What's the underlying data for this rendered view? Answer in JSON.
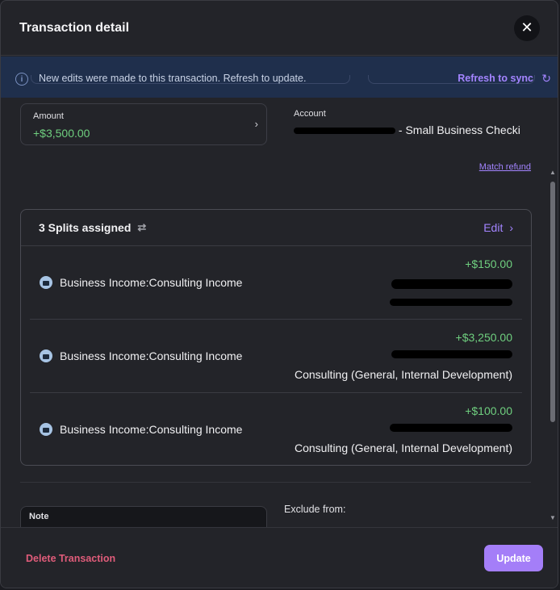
{
  "header": {
    "title": "Transaction detail",
    "close_icon": "close-icon"
  },
  "banner": {
    "message": "New edits were made to this transaction. Refresh to update.",
    "refresh_label": "Refresh to sync",
    "icon": "info-icon"
  },
  "amount": {
    "label": "Amount",
    "value": "+$3,500.00"
  },
  "account": {
    "label": "Account",
    "value_suffix": " - Small Business Checki"
  },
  "match_refund_label": "Match refund",
  "splits": {
    "title": "3 Splits assigned",
    "edit_label": "Edit",
    "rows": [
      {
        "category": "Business Income:Consulting Income",
        "amount": "+$150.00",
        "line3": ""
      },
      {
        "category": "Business Income:Consulting Income",
        "amount": "+$3,250.00",
        "line3": "Consulting (General, Internal Development)"
      },
      {
        "category": "Business Income:Consulting Income",
        "amount": "+$100.00",
        "line3": "Consulting (General, Internal Development)"
      }
    ]
  },
  "note": {
    "label": "Note"
  },
  "exclude_label": "Exclude from:",
  "footer": {
    "delete_label": "Delete Transaction",
    "update_label": "Update"
  },
  "colors": {
    "accent": "#a47ef8",
    "positive": "#6fcf7f",
    "danger": "#e05c7a",
    "banner_bg": "#1f2f4c"
  }
}
